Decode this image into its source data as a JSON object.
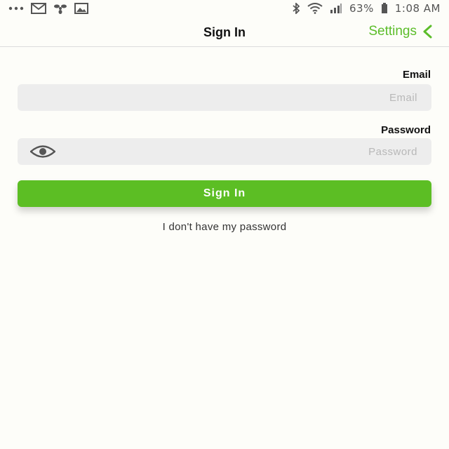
{
  "status_bar": {
    "time": "1:08 AM",
    "battery": "63%",
    "left_icons": [
      "battery-icon",
      "signal-icon",
      "wifi-icon",
      "bluetooth-icon"
    ],
    "right_icons": [
      "image-icon",
      "fan-icon",
      "mail-icon",
      "more-icon"
    ]
  },
  "nav": {
    "title": "Sign In",
    "back_label": "Settings",
    "back_icon": "chevron-left-icon"
  },
  "form": {
    "email_label": "Email",
    "email_placeholder": "Email",
    "email_value": "",
    "password_label": "Password",
    "password_placeholder": "Password",
    "password_value": "",
    "password_toggle_icon": "eye-icon"
  },
  "actions": {
    "sign_in_label": "Sign In",
    "forgot_label": "I don't have my password"
  },
  "colors": {
    "accent": "#5cbe24",
    "background": "#fdfdf9",
    "field": "#ededed"
  }
}
